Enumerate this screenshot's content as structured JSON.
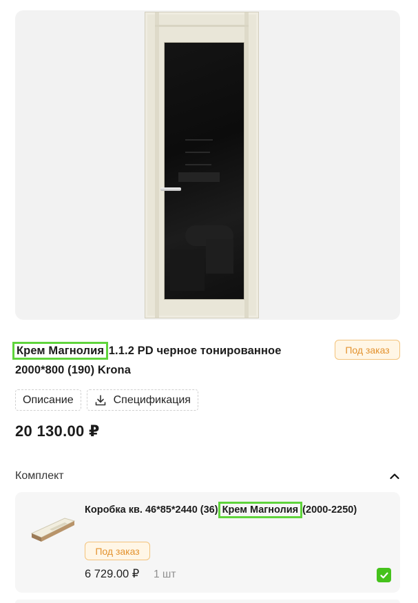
{
  "product": {
    "title_highlight": "Крем Магнолия",
    "title_rest": " 1.1.2 PD черное тонированное 2000*800 (190) Krona",
    "availability_badge": "Под заказ",
    "price": "20 130.00 ₽",
    "image_icon": "door-image"
  },
  "tabs": [
    {
      "label": "Описание",
      "icon": null
    },
    {
      "label": "Спецификация",
      "icon": "download-icon"
    }
  ],
  "kit": {
    "header": "Комплект",
    "expanded": true,
    "items": [
      {
        "title_prefix": "Коробка кв. 46*85*2440 (36) ",
        "title_highlight": "Крем Магнолия",
        "title_suffix": " (2000-2250)",
        "badge": "Под заказ",
        "price": "6 729.00 ₽",
        "quantity": "1 шт",
        "checked": true
      }
    ]
  },
  "colors": {
    "highlight": "#5fd43b",
    "badge_text": "#e3922e",
    "check": "#45c21c"
  }
}
